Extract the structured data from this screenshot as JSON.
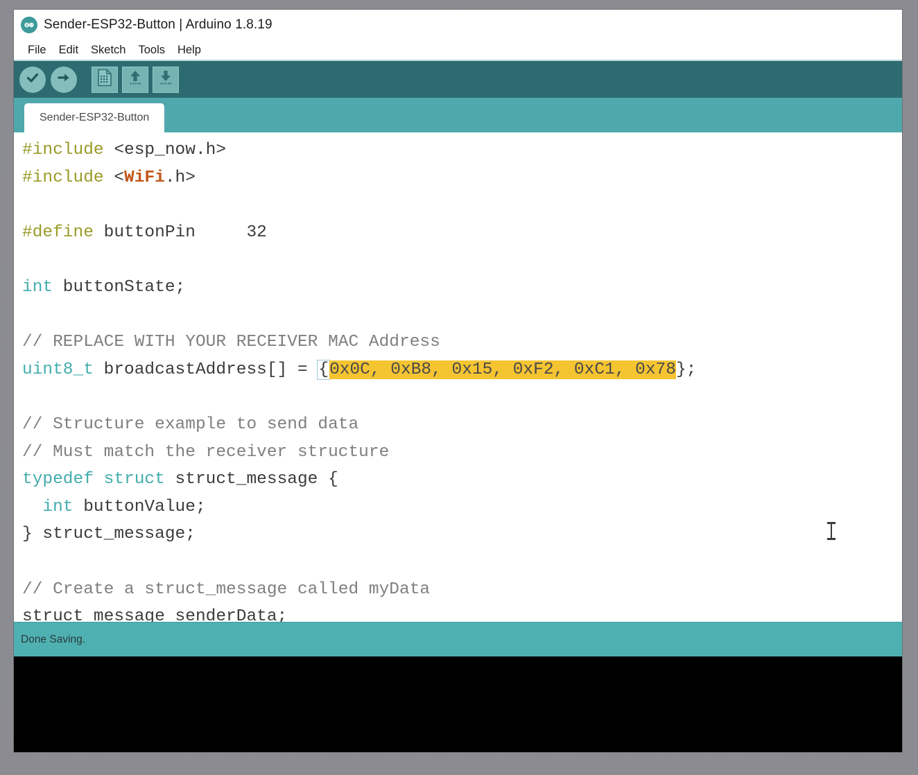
{
  "window": {
    "title": "Sender-ESP32-Button | Arduino 1.8.19",
    "logo_name": "arduino-infinity-logo"
  },
  "menubar": {
    "items": [
      {
        "label": "File"
      },
      {
        "label": "Edit"
      },
      {
        "label": "Sketch"
      },
      {
        "label": "Tools"
      },
      {
        "label": "Help"
      }
    ]
  },
  "toolbar": {
    "buttons": [
      {
        "name": "verify-button",
        "icon": "check-icon",
        "tooltip": "Verify"
      },
      {
        "name": "upload-button",
        "icon": "arrow-right-icon",
        "tooltip": "Upload"
      },
      {
        "name": "new-button",
        "icon": "document-icon",
        "tooltip": "New"
      },
      {
        "name": "open-button",
        "icon": "arrow-up-icon",
        "tooltip": "Open"
      },
      {
        "name": "save-button",
        "icon": "arrow-down-icon",
        "tooltip": "Save"
      }
    ]
  },
  "tabs": {
    "active": "Sender-ESP32-Button",
    "items": [
      {
        "label": "Sender-ESP32-Button"
      }
    ]
  },
  "editor": {
    "lines": [
      {
        "n": 1,
        "tokens": [
          {
            "t": "#include",
            "c": "kw-preproc"
          },
          {
            "t": " <esp_now.h>",
            "c": "plain"
          }
        ]
      },
      {
        "n": 2,
        "tokens": [
          {
            "t": "#include",
            "c": "kw-preproc"
          },
          {
            "t": " <",
            "c": "plain"
          },
          {
            "t": "WiFi",
            "c": "kw-lib"
          },
          {
            "t": ".h>",
            "c": "plain"
          }
        ]
      },
      {
        "n": 3,
        "tokens": []
      },
      {
        "n": 4,
        "tokens": [
          {
            "t": "#define",
            "c": "kw-preproc"
          },
          {
            "t": " buttonPin     32",
            "c": "plain"
          }
        ]
      },
      {
        "n": 5,
        "tokens": []
      },
      {
        "n": 6,
        "tokens": [
          {
            "t": "int",
            "c": "kw-type"
          },
          {
            "t": " buttonState;",
            "c": "plain"
          }
        ]
      },
      {
        "n": 7,
        "tokens": []
      },
      {
        "n": 8,
        "tokens": [
          {
            "t": "// REPLACE WITH YOUR RECEIVER MAC Address",
            "c": "comment"
          }
        ]
      },
      {
        "n": 9,
        "tokens": [
          {
            "t": "uint8_t",
            "c": "kw-type"
          },
          {
            "t": " broadcastAddress[] = ",
            "c": "plain"
          },
          {
            "t": "{",
            "c": "brace-box"
          },
          {
            "t": "0x0C, 0xB8, 0x15, 0xF2, 0xC1, 0x78",
            "c": "sel-hl"
          },
          {
            "t": "};",
            "c": "plain"
          }
        ]
      },
      {
        "n": 10,
        "tokens": []
      },
      {
        "n": 11,
        "tokens": [
          {
            "t": "// Structure example to send data",
            "c": "comment"
          }
        ]
      },
      {
        "n": 12,
        "tokens": [
          {
            "t": "// Must match the receiver structure",
            "c": "comment"
          }
        ]
      },
      {
        "n": 13,
        "tokens": [
          {
            "t": "typedef",
            "c": "kw-type"
          },
          {
            "t": " ",
            "c": "plain"
          },
          {
            "t": "struct",
            "c": "kw-type"
          },
          {
            "t": " struct_message {",
            "c": "plain"
          }
        ]
      },
      {
        "n": 14,
        "tokens": [
          {
            "t": "  ",
            "c": "plain"
          },
          {
            "t": "int",
            "c": "kw-type"
          },
          {
            "t": " buttonValue;",
            "c": "plain"
          }
        ]
      },
      {
        "n": 15,
        "tokens": [
          {
            "t": "} struct_message;",
            "c": "plain"
          }
        ]
      },
      {
        "n": 16,
        "tokens": []
      },
      {
        "n": 17,
        "tokens": [
          {
            "t": "// Create a struct_message called myData",
            "c": "comment"
          }
        ]
      },
      {
        "n": 18,
        "tokens": [
          {
            "t": "struct message senderData;",
            "c": "plain"
          }
        ]
      }
    ],
    "selection_text": "0x0C, 0xB8, 0x15, 0xF2, 0xC1, 0x78",
    "mac_address_bytes": [
      "0x0C",
      "0xB8",
      "0x15",
      "0xF2",
      "0xC1",
      "0x78"
    ]
  },
  "statusbar": {
    "message": "Done Saving."
  },
  "console": {
    "text": ""
  },
  "colors": {
    "toolbar_bg": "#2c6b70",
    "tabbar_bg": "#4fa8ac",
    "statusbar_bg": "#4fb0b2",
    "console_bg": "#000000",
    "selection_highlight": "#f5c431",
    "keyword_type": "#44adad",
    "keyword_preprocessor": "#9a9b28",
    "library_name": "#c2571a",
    "comment": "#7f7f7f",
    "desktop_bg": "#8b8b92"
  }
}
